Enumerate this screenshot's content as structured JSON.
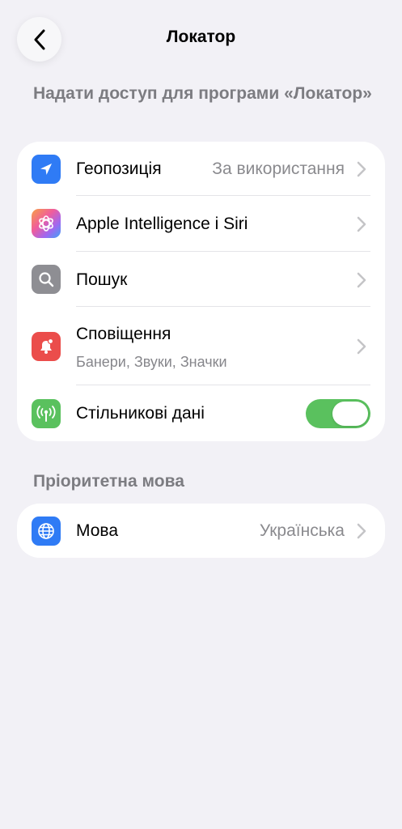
{
  "nav": {
    "title": "Локатор"
  },
  "access_section": {
    "header": "Надати доступ для програми «Локатор»",
    "items": [
      {
        "label": "Геопозиція",
        "value": "За використання",
        "icon": "location-arrow-icon",
        "icon_color": "#2f7bf5"
      },
      {
        "label": "Apple Intelligence і Siri",
        "icon": "apple-intelligence-icon"
      },
      {
        "label": "Пошук",
        "icon": "search-icon",
        "icon_color": "#8e8e93"
      },
      {
        "label": "Сповіщення",
        "sublabel": "Банери, Звуки, Значки",
        "icon": "notifications-icon",
        "icon_color": "#eb4d4b"
      },
      {
        "label": "Стільникові дані",
        "icon": "cellular-icon",
        "icon_color": "#5ac15e",
        "toggle_on": true
      }
    ]
  },
  "language_section": {
    "header": "Пріоритетна мова",
    "items": [
      {
        "label": "Мова",
        "value": "Українська",
        "icon": "globe-icon",
        "icon_color": "#2f7bf5"
      }
    ]
  }
}
